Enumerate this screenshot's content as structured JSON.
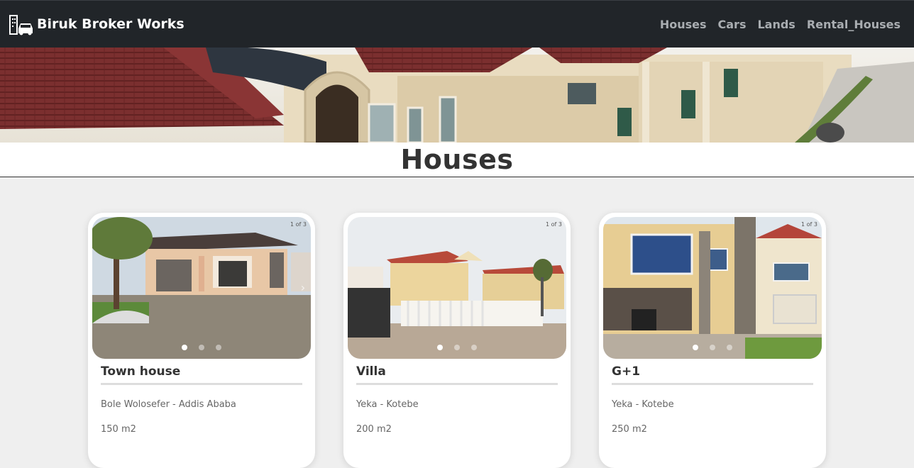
{
  "navbar": {
    "brand": "Biruk Broker Works",
    "brand_icon": "building-car-icon",
    "links": [
      "Houses",
      "Cars",
      "Lands",
      "Rental_Houses"
    ]
  },
  "page": {
    "title": "Houses"
  },
  "listings": [
    {
      "title": "Town house",
      "location": "Bole Wolosefer - Addis Ababa",
      "area": "150 m2",
      "counter": "1 of 3",
      "slides": 3,
      "active_slide": 1
    },
    {
      "title": "Villa",
      "location": "Yeka - Kotebe",
      "area": "200 m2",
      "counter": "1 of 3",
      "slides": 3,
      "active_slide": 1
    },
    {
      "title": "G+1",
      "location": "Yeka - Kotebe",
      "area": "250 m2",
      "counter": "1 of 3",
      "slides": 3,
      "active_slide": 1
    }
  ],
  "colors": {
    "navbar_bg": "#212529",
    "nav_link": "#a9adb1",
    "page_bg": "#efefef"
  }
}
